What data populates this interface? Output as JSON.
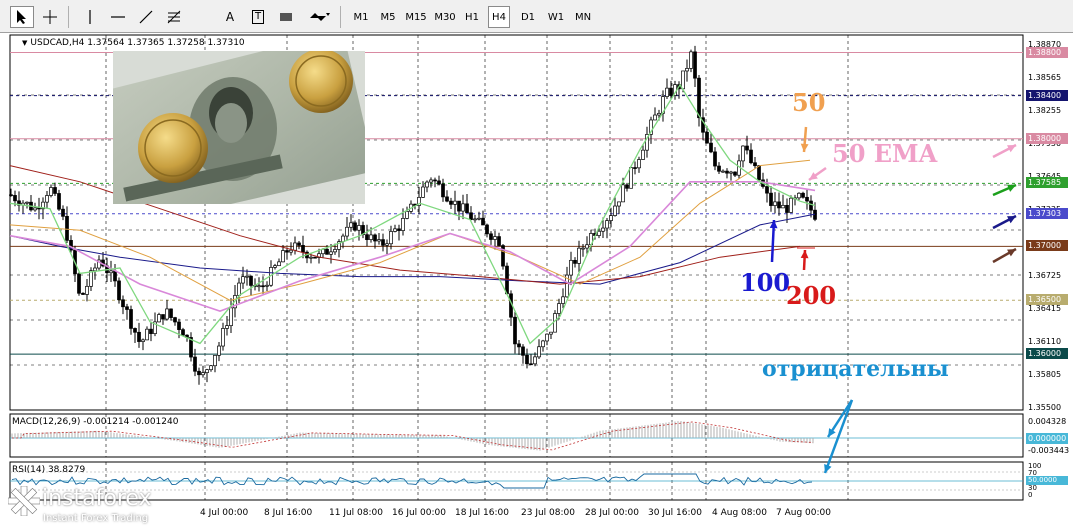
{
  "toolbar": {
    "timeframes": [
      {
        "label": "M1",
        "active": false
      },
      {
        "label": "M5",
        "active": false
      },
      {
        "label": "M15",
        "active": false
      },
      {
        "label": "M30",
        "active": false
      },
      {
        "label": "H1",
        "active": false
      },
      {
        "label": "H4",
        "active": true
      },
      {
        "label": "D1",
        "active": false
      },
      {
        "label": "W1",
        "active": false
      },
      {
        "label": "MN",
        "active": false
      }
    ],
    "tools": [
      "cursor-icon",
      "crosshair-icon",
      "vertical-line-icon",
      "horizontal-line-icon",
      "trendline-icon",
      "fibonacci-icon",
      "text-icon",
      "text-label-icon",
      "rectangle-icon",
      "arrows-icon"
    ],
    "text_tool_label": "A",
    "text_label_tool_label": "T"
  },
  "chart": {
    "title": "USDCAD,H4  1.37564 1.37365 1.37258 1.37310",
    "macd_label": "MACD(12,26,9) -0.001214 -0.001240",
    "rsi_label": "RSI(14) 38.8279",
    "price_scale": [
      "1.38870",
      "1.38565",
      "1.38255",
      "1.37950",
      "1.37645",
      "1.37335",
      "1.37025",
      "1.36725",
      "1.36415",
      "1.36110",
      "1.35805",
      "1.35500"
    ],
    "price_levels": [
      {
        "label": "1.38800",
        "color": "#d98aa2"
      },
      {
        "label": "1.38400",
        "color": "#14146e"
      },
      {
        "label": "1.38000",
        "color": "#d98aa2"
      },
      {
        "label": "1.37585",
        "color": "#2fa02f"
      },
      {
        "label": "1.37303",
        "color": "#4a4acb"
      },
      {
        "label": "1.37000",
        "color": "#7a3b1a"
      },
      {
        "label": "1.36500",
        "color": "#b8ac6e"
      },
      {
        "label": "1.36000",
        "color": "#0b4a4a"
      }
    ],
    "macd_scale": [
      "0.004328",
      "0.000000",
      "-0.003443"
    ],
    "rsi_scale": [
      "100",
      "70",
      "50.0000",
      "30",
      "0"
    ],
    "time_labels": [
      "4 Jul 00:00",
      "8 Jul 16:00",
      "11 Jul 08:00",
      "16 Jul 00:00",
      "18 Jul 16:00",
      "23 Jul 08:00",
      "28 Jul 00:00",
      "30 Jul 16:00",
      "4 Aug 08:00",
      "7 Aug 00:00"
    ],
    "annotations": {
      "ema50_short": "50",
      "ema50_long": "50 EMA",
      "ma100": "100",
      "ma200": "200",
      "negative": "отрицательны"
    },
    "colors": {
      "ema10": "#7fd87f",
      "ema50": "#d988d9",
      "ema100": "#1a1a8a",
      "ema200": "#a0201a",
      "ema50b": "#e0a040",
      "candle_up": "#ffffff",
      "candle_down": "#000000",
      "annot_orange": "#f0a050",
      "annot_pink": "#f0a0c8",
      "annot_blue": "#1a1ad0",
      "annot_red": "#d81a1a",
      "annot_cyan": "#1a90d0"
    }
  },
  "logo": {
    "name": "instaforex",
    "tagline": "Instant Forex Trading"
  }
}
